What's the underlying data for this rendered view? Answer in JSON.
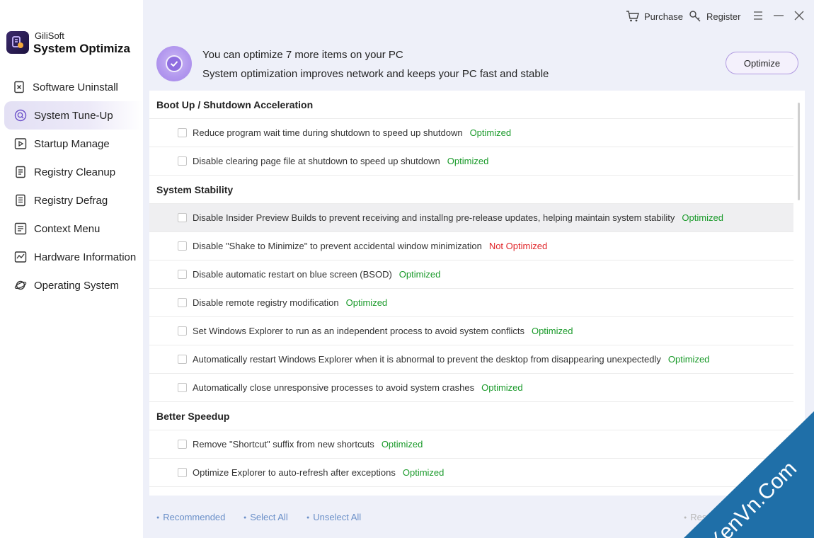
{
  "app": {
    "company": "GiliSoft",
    "product": "System Optimiza"
  },
  "sidebar": {
    "items": [
      {
        "label": "Software Uninstall",
        "icon": "uninstall-icon"
      },
      {
        "label": "System Tune-Up",
        "icon": "tuneup-icon",
        "active": true
      },
      {
        "label": "Startup Manage",
        "icon": "startup-icon"
      },
      {
        "label": "Registry Cleanup",
        "icon": "registry-cleanup-icon"
      },
      {
        "label": "Registry Defrag",
        "icon": "registry-defrag-icon"
      },
      {
        "label": "Context Menu",
        "icon": "context-menu-icon"
      },
      {
        "label": "Hardware Information",
        "icon": "hardware-icon"
      },
      {
        "label": "Operating System",
        "icon": "planet-icon"
      }
    ]
  },
  "topbar": {
    "purchase": "Purchase",
    "register": "Register"
  },
  "banner": {
    "line1": "You can optimize 7 more items on your PC",
    "line2": "System optimization improves network and keeps your PC fast and stable",
    "button": "Optimize"
  },
  "list": {
    "sections": [
      {
        "title": "Boot Up / Shutdown Acceleration",
        "items": [
          {
            "text": "Reduce program wait time during shutdown to speed up shutdown",
            "status": "Optimized"
          },
          {
            "text": "Disable clearing page file at shutdown to speed up shutdown",
            "status": "Optimized"
          }
        ]
      },
      {
        "title": "System Stability",
        "items": [
          {
            "text": "Disable Insider Preview Builds to prevent receiving and installng pre-release updates, helping maintain system stability",
            "status": "Optimized"
          },
          {
            "text": "Disable \"Shake to Minimize\" to prevent accidental window minimization",
            "status": "Not Optimized"
          },
          {
            "text": "Disable automatic restart on blue screen (BSOD)",
            "status": "Optimized"
          },
          {
            "text": "Disable remote registry modification",
            "status": "Optimized"
          },
          {
            "text": "Set Windows Explorer to run as an independent process to avoid system conflicts",
            "status": "Optimized"
          },
          {
            "text": "Automatically restart Windows Explorer when it is abnormal to prevent the desktop from disappearing unexpectedly",
            "status": "Optimized"
          },
          {
            "text": "Automatically close unresponsive processes to avoid system crashes",
            "status": "Optimized"
          }
        ]
      },
      {
        "title": "Better Speedup",
        "items": [
          {
            "text": "Remove \"Shortcut\" suffix from new shortcuts",
            "status": "Optimized"
          },
          {
            "text": "Optimize Explorer to auto-refresh after exceptions",
            "status": "Optimized"
          }
        ]
      }
    ]
  },
  "footer": {
    "recommended": "Recommended",
    "select_all": "Select All",
    "unselect_all": "Unselect All",
    "restore": "Restore System Defaults"
  },
  "watermark": "XenVn.Com",
  "colors": {
    "accent": "#8f6ee0",
    "ok": "#1a9a2a",
    "bad": "#e0262a",
    "link": "#6a8fc8",
    "watermark": "#1f6fa8"
  }
}
